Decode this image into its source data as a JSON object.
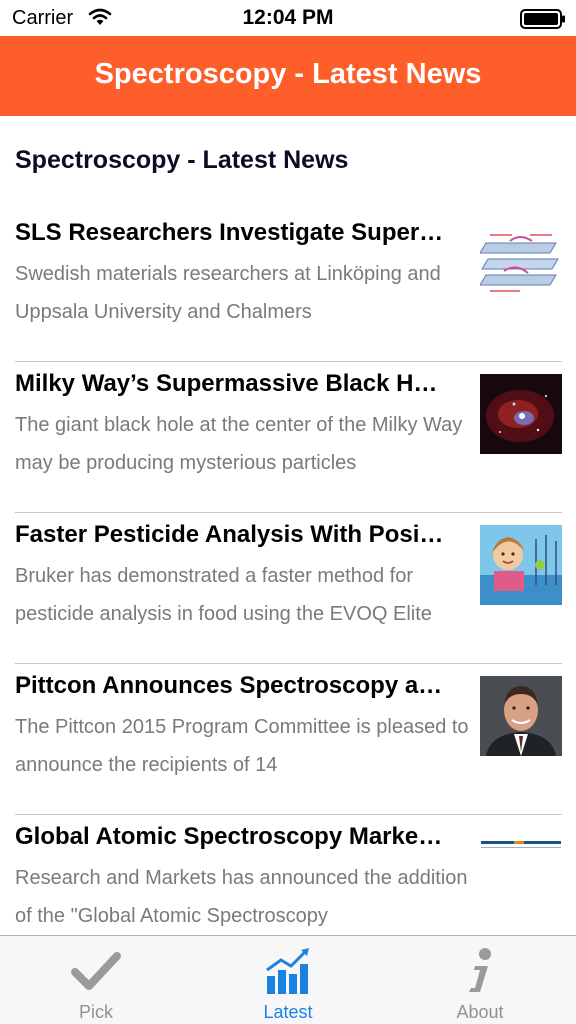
{
  "status_bar": {
    "carrier": "Carrier",
    "time": "12:04 PM"
  },
  "nav_bar": {
    "title": "Spectroscopy - Latest News",
    "background_color": "#fd5e2a"
  },
  "feed": {
    "heading": "Spectroscopy - Latest News",
    "articles": [
      {
        "title": "SLS Researchers Investigate Super…",
        "summary": "Swedish materials researchers at Linköping and Uppsala University and Chalmers",
        "thumbnail": "layered-diagram-thumbnail"
      },
      {
        "title": "Milky Way’s Supermassive Black H…",
        "summary": "The giant black hole at the center of the Milky Way may be producing mysterious particles",
        "thumbnail": "galaxy-thumbnail"
      },
      {
        "title": "Faster Pesticide Analysis With Posi…",
        "summary": "Bruker has demonstrated a faster method for pesticide analysis in food using the EVOQ Elite",
        "thumbnail": "child-field-thumbnail"
      },
      {
        "title": "Pittcon Announces Spectroscopy a…",
        "summary": "The Pittcon 2015 Program Committee is pleased to announce the recipients of 14",
        "thumbnail": "portrait-thumbnail"
      },
      {
        "title": "Global Atomic Spectroscopy Marke…",
        "summary": "Research and Markets has announced the addition of the \"Global Atomic Spectroscopy",
        "thumbnail": "research-and-markets-logo"
      }
    ]
  },
  "tab_bar": {
    "active_color": "#1a82e2",
    "tabs": [
      {
        "label": "Pick",
        "icon": "checkmark-icon",
        "active": false
      },
      {
        "label": "Latest",
        "icon": "chart-icon",
        "active": true
      },
      {
        "label": "About",
        "icon": "info-icon",
        "active": false
      }
    ]
  }
}
